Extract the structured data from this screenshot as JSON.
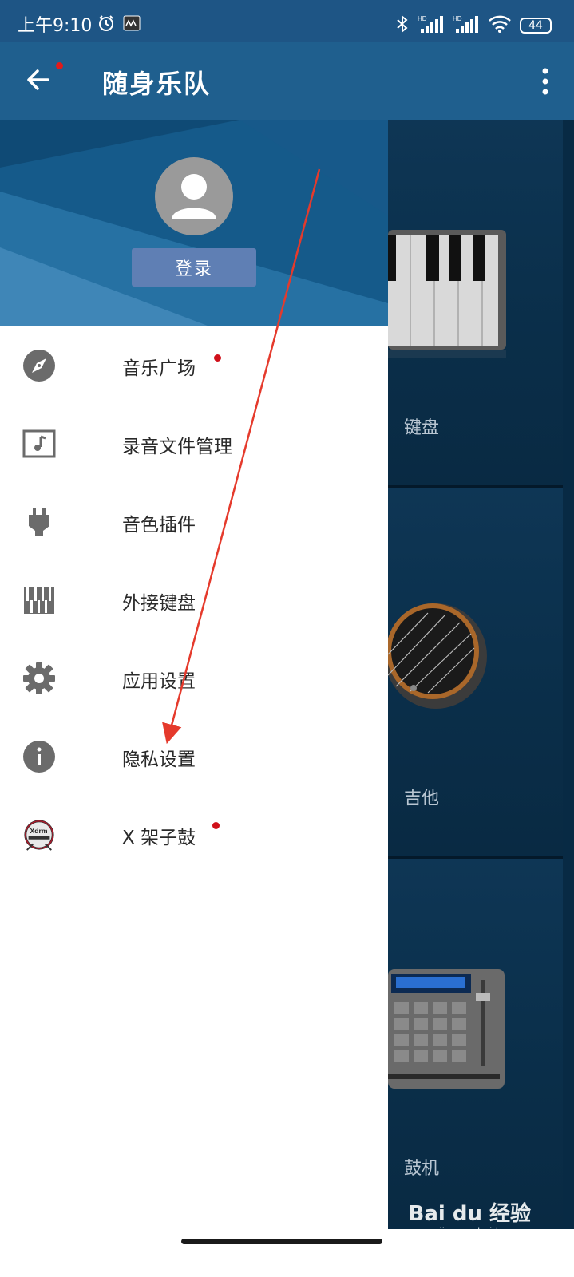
{
  "status_bar": {
    "time": "上午9:10",
    "battery": "44",
    "icons": [
      "alarm-icon",
      "media-icon",
      "bluetooth-icon",
      "hd-signal-icon",
      "hd-signal-icon",
      "wifi-icon",
      "battery-icon"
    ]
  },
  "app_bar": {
    "title": "随身乐队",
    "back_icon": "arrow-back-icon",
    "more_icon": "more-vert-icon"
  },
  "drawer": {
    "login_label": "登录",
    "menu": [
      {
        "label": "音乐广场",
        "icon": "compass-icon",
        "badge": true
      },
      {
        "label": "录音文件管理",
        "icon": "music-file-icon",
        "badge": false
      },
      {
        "label": "音色插件",
        "icon": "plugin-icon",
        "badge": false
      },
      {
        "label": "外接键盘",
        "icon": "piano-keys-icon",
        "badge": false
      },
      {
        "label": "应用设置",
        "icon": "gear-icon",
        "badge": false
      },
      {
        "label": "隐私设置",
        "icon": "info-icon",
        "badge": false
      },
      {
        "label": "X 架子鼓",
        "icon": "drum-kit-icon",
        "badge": true
      }
    ]
  },
  "instruments": [
    {
      "label": "键盘"
    },
    {
      "label": "吉他"
    },
    {
      "label": "鼓机"
    }
  ],
  "colors": {
    "app_bar": "#1f5f8e",
    "drawer_header": "#155a8a",
    "login_button": "#5f7fb4",
    "badge": "#d0101a",
    "annotation_arrow": "#e53a2c"
  },
  "watermark": {
    "main": "Bai du 经验",
    "sub": "jingyan.baidu.com"
  }
}
